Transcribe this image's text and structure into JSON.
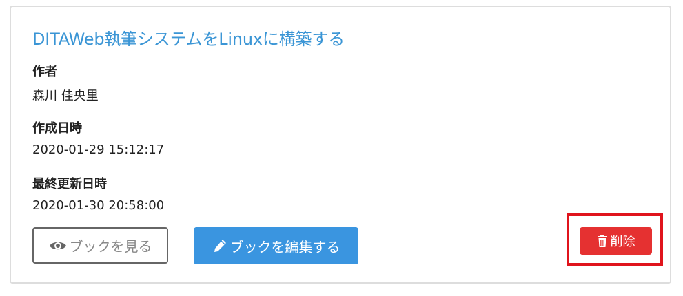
{
  "book": {
    "title": "DITAWeb執筆システムをLinuxに構築する",
    "author_label": "作者",
    "author": "森川 佳央里",
    "created_label": "作成日時",
    "created": "2020-01-29 15:12:17",
    "updated_label": "最終更新日時",
    "updated": "2020-01-30 20:58:00"
  },
  "actions": {
    "view_label": "ブックを見る",
    "view_icon": "eye-icon",
    "edit_label": "ブックを編集する",
    "edit_icon": "pencil-icon",
    "delete_label": "削除",
    "delete_icon": "trash-icon"
  },
  "colors": {
    "title": "#3a95d5",
    "edit_button": "#3a95e0",
    "delete_button": "#e53131",
    "highlight_box": "#e0141c"
  }
}
